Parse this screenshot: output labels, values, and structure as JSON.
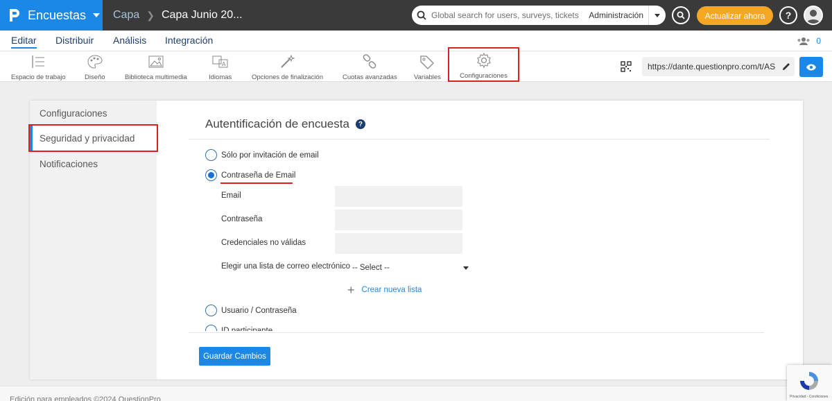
{
  "topbar": {
    "product": "Encuestas",
    "breadcrumb_root": "Capa",
    "breadcrumb_current": "Capa Junio 20...",
    "search_placeholder": "Global search for users, surveys, tickets",
    "search_scope": "Administración",
    "upgrade_label": "Actualizar ahora",
    "help_label": "?"
  },
  "menu": {
    "items": [
      "Editar",
      "Distribuir",
      "Análisis",
      "Integración"
    ],
    "collaborators_count": "0"
  },
  "toolbar": {
    "tools": [
      {
        "label": "Espacio de trabajo",
        "icon": "workspace-icon"
      },
      {
        "label": "Diseño",
        "icon": "palette-icon"
      },
      {
        "label": "Biblioteca multimedia",
        "icon": "image-icon"
      },
      {
        "label": "Idiomas",
        "icon": "translate-icon"
      },
      {
        "label": "Opciones de finalización",
        "icon": "magic-wand-icon"
      },
      {
        "label": "Cuotas avanzadas",
        "icon": "link-chain-icon"
      },
      {
        "label": "Variables",
        "icon": "tag-icon"
      },
      {
        "label": "Configuraciones",
        "icon": "gear-icon"
      }
    ],
    "survey_url": "https://dante.questionpro.com/t/AS"
  },
  "sidebar": {
    "items": [
      "Configuraciones",
      "Seguridad y privacidad",
      "Notificaciones"
    ]
  },
  "main": {
    "title": "Autentificación de encuesta",
    "options": {
      "email_invite": "Sólo por invitación de email",
      "email_password": "Contraseña de Email",
      "user_password": "Usuario / Contraseña",
      "participant_id": "ID participante"
    },
    "fields": {
      "email": "Email",
      "password": "Contraseña",
      "invalid_credentials": "Credenciales no válidas",
      "email_list": "Elegir una lista de correo electrónico",
      "email_list_value": "-- Select --"
    },
    "create_list": "Crear nueva lista",
    "save": "Guardar Cambios"
  },
  "footer": {
    "text": "Edición para empleados ©2024 QuestionPro",
    "recaptcha": "Privacidad - Condiciones"
  },
  "colors": {
    "brand_blue": "#1b87e6",
    "topbar": "#3a3a3a",
    "upgrade": "#f5a623",
    "highlight_red": "#e0201a"
  }
}
